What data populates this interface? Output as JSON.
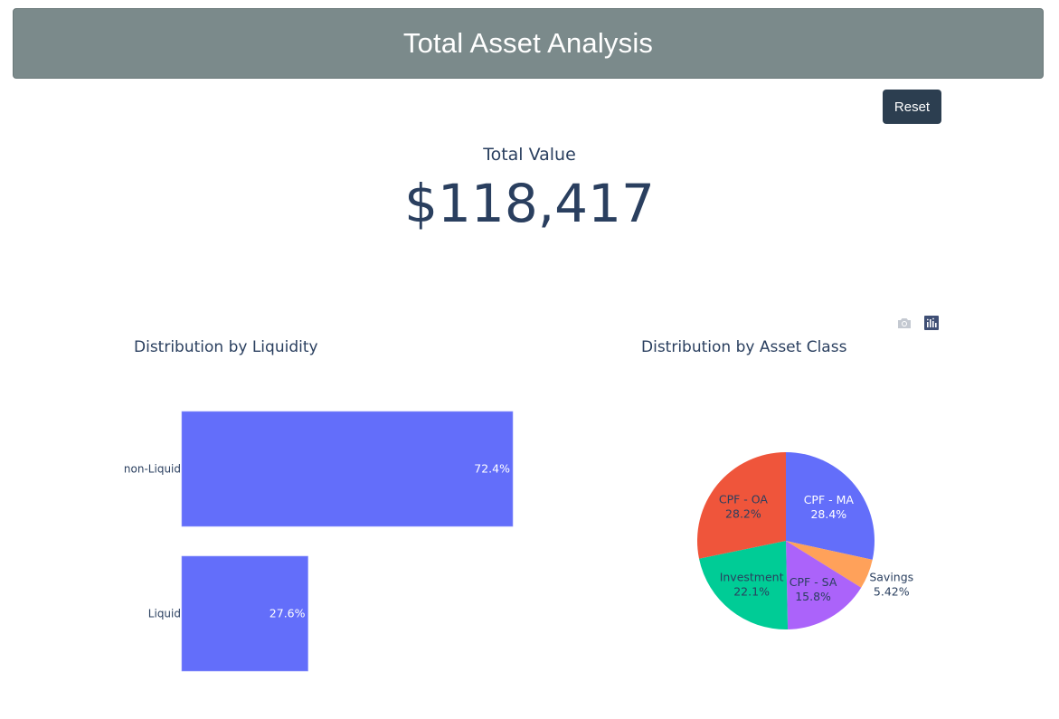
{
  "header": {
    "title": "Total Asset Analysis"
  },
  "controls": {
    "reset_label": "Reset"
  },
  "indicator": {
    "label": "Total Value",
    "value": "$118,417"
  },
  "modebar": {
    "icons": [
      "camera-icon",
      "plotly-logo-icon"
    ]
  },
  "colors": {
    "header_bg": "#7b8a8b",
    "button_bg": "#2c3e50",
    "text": "#2a3f5f",
    "bar": "#636efa"
  },
  "chart_data": [
    {
      "type": "bar",
      "orientation": "horizontal",
      "title": "Distribution by Liquidity",
      "categories": [
        "non-Liquid",
        "Liquid"
      ],
      "values": [
        72.4,
        27.6
      ],
      "labels": [
        "72.4%",
        "27.6%"
      ],
      "unit": "%",
      "color": "#636efa"
    },
    {
      "type": "pie",
      "title": "Distribution by Asset Class",
      "slices": [
        {
          "label": "CPF - MA",
          "value": 28.4,
          "text": "28.4%",
          "color": "#636efa"
        },
        {
          "label": "Savings",
          "value": 5.42,
          "text": "5.42%",
          "color": "#ffa15a"
        },
        {
          "label": "CPF - SA",
          "value": 15.8,
          "text": "15.8%",
          "color": "#ab63fa"
        },
        {
          "label": "Investment",
          "value": 22.1,
          "text": "22.1%",
          "color": "#00cc96"
        },
        {
          "label": "CPF - OA",
          "value": 28.2,
          "text": "28.2%",
          "color": "#ef553b"
        }
      ]
    }
  ]
}
